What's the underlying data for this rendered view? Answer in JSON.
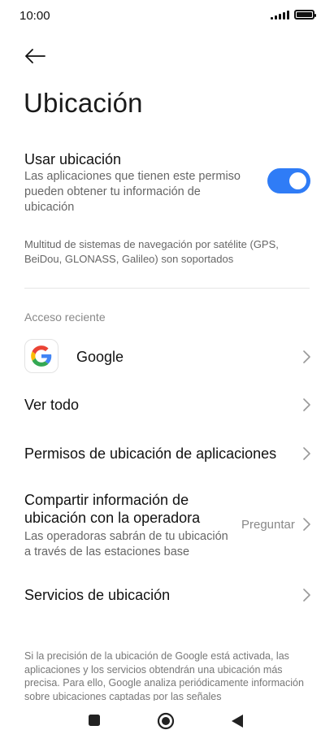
{
  "status_bar": {
    "time": "10:00"
  },
  "page": {
    "title": "Ubicación"
  },
  "use_location": {
    "title": "Usar ubicación",
    "description": "Las aplicaciones que tienen este permiso pueden obtener tu información de ubicación",
    "enabled": true,
    "toggle_color": "#2f7cf6"
  },
  "gnss_note": "Multitud de sistemas de navegación por satélite (GPS, BeiDou, GLONASS, Galileo) son soportados",
  "recent_access": {
    "label": "Acceso reciente",
    "apps": [
      {
        "name": "Google",
        "icon": "google-logo-icon"
      }
    ]
  },
  "menu": {
    "see_all": "Ver todo",
    "app_permissions": "Permisos de ubicación de aplicaciones",
    "share_carrier": {
      "title_line1": "Compartir información de",
      "title_line2": "ubicación con la operadora",
      "value": "Preguntar",
      "description": "Las operadoras sabrán de tu ubicación a través de las estaciones base"
    },
    "location_services": "Servicios de ubicación"
  },
  "footer": "Si la precisión de la ubicación de Google está activada, las aplicaciones y los servicios obtendrán una ubicación más precisa. Para ello, Google analiza periódicamente información sobre ubicaciones captadas por las señales",
  "nav_bar": {
    "icons": [
      "recents-square-icon",
      "home-circle-icon",
      "back-triangle-icon"
    ]
  }
}
